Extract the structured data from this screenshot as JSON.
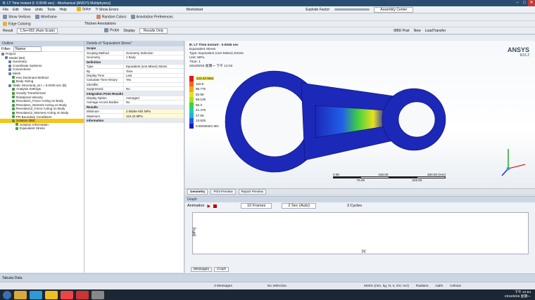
{
  "titlebar": {
    "title": "B: LT Time Instant (t: 0.0045 sec) - Mechanical [ANSYS Multiphysics]"
  },
  "menu": [
    "File",
    "Edit",
    "View",
    "Units",
    "Tools",
    "Help"
  ],
  "toolbar1": {
    "solve": "Solve",
    "show_errors": "?/ Show Errors",
    "worksheet": "Worksheet",
    "explode_factor": "Explode Factor:",
    "assembly_center": "Assembly Center"
  },
  "toolbar2": {
    "show_vertices": "Show Vertices",
    "wireframe": "Wireframe",
    "random_colors": "Random Colors",
    "annotation_prefs": "Annotation Preferences"
  },
  "toolbar3": {
    "edge_coloring": "Edge Coloring",
    "thicken": "Thicken Annotations"
  },
  "toolbar4": {
    "result_label": "Result",
    "result_value": "1.5e+002 (Auto Scale)",
    "probe": "Probe",
    "display": "Display",
    "results_only": "Results Only",
    "mbd_post": "MBD Post",
    "new": "New",
    "load_transfer": "LoadTransfer"
  },
  "outline": {
    "header": "Outline",
    "filter_label": "Filter:",
    "filter_value": "Name",
    "items": [
      {
        "label": "Project",
        "indent": 0
      },
      {
        "label": "Model (B4)",
        "indent": 1
      },
      {
        "label": "Geometry",
        "indent": 2
      },
      {
        "label": "Coordinate Systems",
        "indent": 2
      },
      {
        "label": "Connections",
        "indent": 2
      },
      {
        "label": "Mesh",
        "indent": 2
      },
      {
        "label": "Hex Dominant Method",
        "indent": 3
      },
      {
        "label": "Body Sizing",
        "indent": 3
      },
      {
        "label": "Static Structural_at t = 0.0045 sec (B)",
        "indent": 2
      },
      {
        "label": "Analysis Settings",
        "indent": 3
      },
      {
        "label": "Gravity Transformed",
        "indent": 3
      },
      {
        "label": "Rotational Velocity",
        "indent": 3
      },
      {
        "label": "Revolute1_Force Acting on Body",
        "indent": 3
      },
      {
        "label": "Revolute1_Moment Acting on Body",
        "indent": 3
      },
      {
        "label": "Revolute12_Force Acting on Body",
        "indent": 3
      },
      {
        "label": "Revolute12_Moment Acting on Body",
        "indent": 3
      },
      {
        "label": "PR Boundary Conditions",
        "indent": 3
      },
      {
        "label": "Solution (B6)",
        "indent": 3,
        "selected": true
      },
      {
        "label": "Solution Information",
        "indent": 4
      },
      {
        "label": "Equivalent Stress",
        "indent": 4
      }
    ]
  },
  "details": {
    "header": "Details of \"Equivalent Stress\"",
    "rows": [
      {
        "k": "Scope",
        "v": "",
        "sec": true
      },
      {
        "k": "Scoping Method",
        "v": "Geometry Selection"
      },
      {
        "k": "Geometry",
        "v": "1 Body"
      },
      {
        "k": "Definition",
        "v": "",
        "sec": true
      },
      {
        "k": "Type",
        "v": "Equivalent (von-Mises) Stress"
      },
      {
        "k": "By",
        "v": "Time"
      },
      {
        "k": "Display Time",
        "v": "Last"
      },
      {
        "k": "Calculate Time History",
        "v": "Yes"
      },
      {
        "k": "Identifier",
        "v": ""
      },
      {
        "k": "Suppressed",
        "v": "No"
      },
      {
        "k": "Integration Point Results",
        "v": "",
        "sec": true
      },
      {
        "k": "Display Option",
        "v": "Averaged"
      },
      {
        "k": "Average Across Bodies",
        "v": "No"
      },
      {
        "k": "Results",
        "v": "",
        "sec": true
      },
      {
        "k": "Minimum",
        "v": "2.9926e-004 MPa",
        "hi": true
      },
      {
        "k": "Maximum",
        "v": "124.42 MPa",
        "hi": true
      },
      {
        "k": "Information",
        "v": "",
        "sec": true
      }
    ]
  },
  "viewport": {
    "title": "B: LT Time Instant - 0.0045 sec",
    "lines": [
      "Equivalent Stress",
      "Type: Equivalent (von-Mises) Stress",
      "Unit: MPa",
      "Time: 1",
      "2016/9/26 星期一 下午 12:03"
    ],
    "logo": "ANSYS",
    "version": "R16.2",
    "legend": [
      {
        "label": "124.42 Max",
        "color": "#e8141c"
      },
      {
        "label": "110.6",
        "color": "#f06a10"
      },
      {
        "label": "96.775",
        "color": "#f0a818"
      },
      {
        "label": "82.95",
        "color": "#e8e020"
      },
      {
        "label": "69.125",
        "color": "#a8e028"
      },
      {
        "label": "55.3",
        "color": "#40d040"
      },
      {
        "label": "41.475",
        "color": "#20d0a0"
      },
      {
        "label": "27.65",
        "color": "#20b0e0"
      },
      {
        "label": "13.825",
        "color": "#2060e8"
      },
      {
        "label": "0.00029261 Min",
        "color": "#1a1ac8"
      }
    ],
    "scale": {
      "a": "0.00",
      "b": "150.00",
      "c": "300.00 (mm)",
      "d": "75.00",
      "e": "225.00"
    }
  },
  "graphics_tabs": [
    "Geometry",
    "Print Preview",
    "Report Preview"
  ],
  "graph": {
    "header": "Graph",
    "animation": "Animation",
    "frames": "10 Frames",
    "speed": "2 Sec (Auto)",
    "cycles": "3 Cycles",
    "ylabel": "[MPa]",
    "xlabel": "[s]",
    "tabs": [
      "Messages",
      "Graph"
    ]
  },
  "tabular": {
    "header": "Tabular Data"
  },
  "status": {
    "messages": "3 Messages",
    "selection": "No Selection",
    "units": "Metric (mm, kg, N, s, mV, mA)",
    "degrees": "Degrees",
    "rad": "rad/s",
    "celsius": "Celsius",
    "radians": "Radians"
  },
  "taskbar": {
    "time": "下午 12:54",
    "date": "2016/9/26 星期一"
  },
  "colors": {
    "mesh_blue": "#1c28b8",
    "title_bg": "#2a4d72"
  }
}
